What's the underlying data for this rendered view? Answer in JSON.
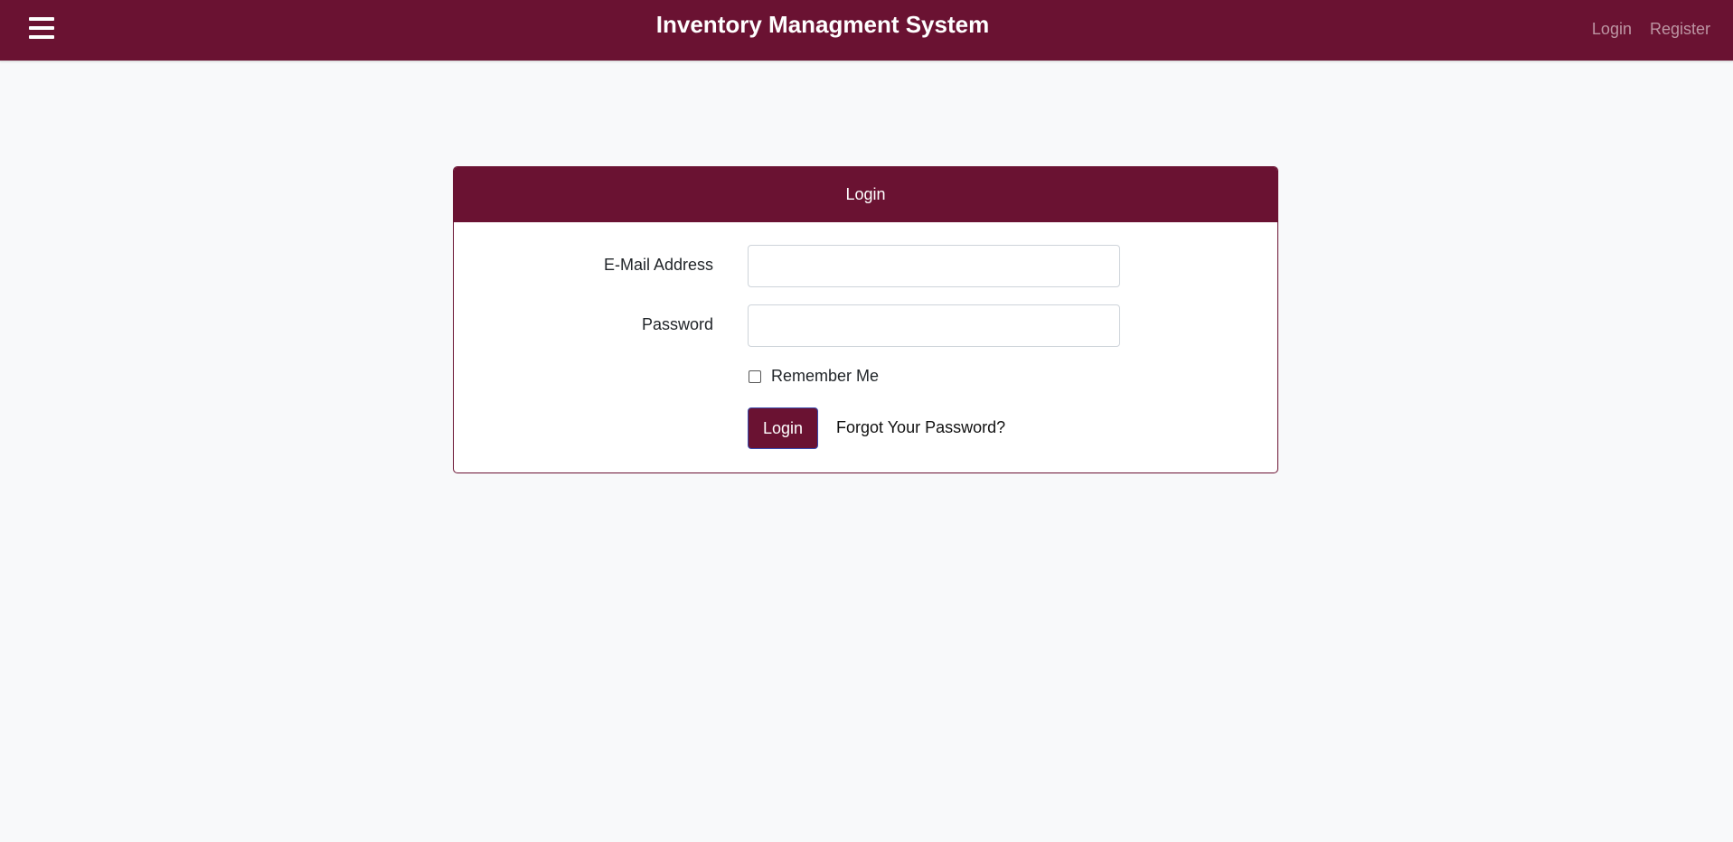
{
  "navbar": {
    "menu_icon": "hamburger-menu-icon",
    "title": "Inventory Managment System",
    "links": {
      "login": "Login",
      "register": "Register"
    },
    "bg_color": "#6a1232"
  },
  "login_card": {
    "header": "Login",
    "email": {
      "label": "E-Mail Address",
      "value": "",
      "placeholder": ""
    },
    "password": {
      "label": "Password",
      "value": "",
      "placeholder": ""
    },
    "remember": {
      "label": "Remember Me",
      "checked": false
    },
    "submit_label": "Login",
    "forgot_label": "Forgot Your Password?"
  }
}
